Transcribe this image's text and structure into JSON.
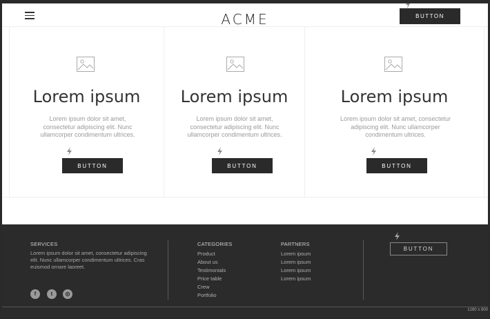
{
  "header": {
    "logo": "ACME",
    "button_label": "BUTTON"
  },
  "features": [
    {
      "title": "Lorem ipsum",
      "text": "Lorem ipsum dolor sit amet, consectetur adipiscing elit. Nunc ullamcorper condimentum ultrices.",
      "button_label": "BUTTON"
    },
    {
      "title": "Lorem ipsum",
      "text": "Lorem ipsum dolor sit amet, consectetur adipiscing elit. Nunc ullamcorper condimentum ultrices.",
      "button_label": "BUTTON"
    },
    {
      "title": "Lorem ipsum",
      "text": "Lorem ipsum dolor sit amet, consectetur adipiscing elit. Nunc ullamcorper condimentum ultrices.",
      "button_label": "BUTTON"
    }
  ],
  "footer": {
    "services": {
      "heading": "SERVICES",
      "text": "Lorem ipsum dolor sit amet, consectetur adipiscing elit. Nunc ullamcorper condimentum ultrices. Cras euismod ornare laoreet."
    },
    "categories": {
      "heading": "CATEGORIES",
      "items": [
        "Product",
        "About us",
        "Testimonials",
        "Price table",
        "Crew",
        "Portfolio"
      ]
    },
    "partners": {
      "heading": "PARTNERS",
      "items": [
        "Lorem ipsum",
        "Lorem ipsum",
        "Lorem ipsum",
        "Lorem ipsum"
      ]
    },
    "social": [
      {
        "icon": "facebook-icon",
        "glyph": "f"
      },
      {
        "icon": "twitter-icon",
        "glyph": "t"
      },
      {
        "icon": "dribbble-icon",
        "glyph": "◎"
      }
    ],
    "button_label": "BUTTON",
    "dimensions_note": "1280 x 800"
  },
  "colors": {
    "dark": "#2a2a2a",
    "footer_bg": "#2b2b2b",
    "muted_text": "#9a9a9a"
  }
}
